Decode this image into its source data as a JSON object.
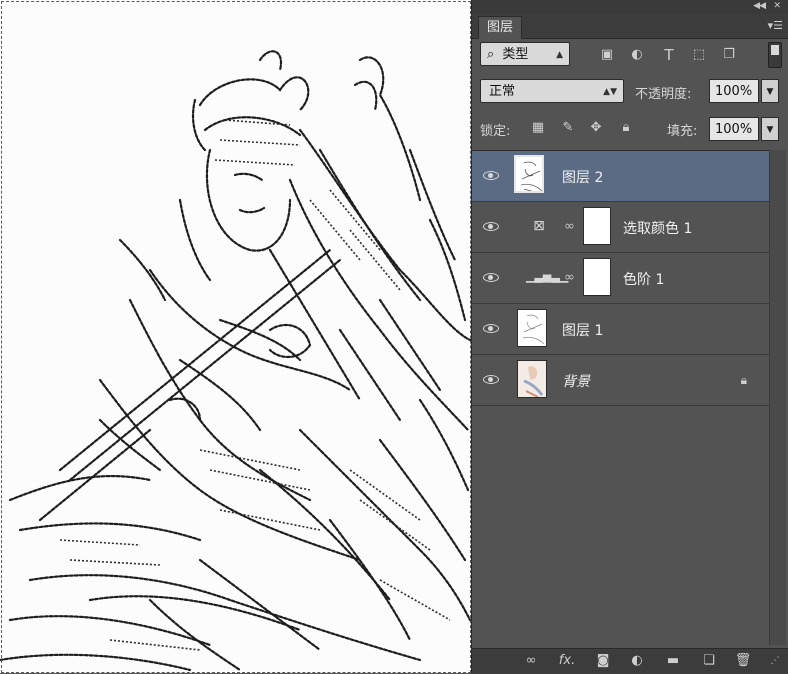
{
  "panel": {
    "tab_title": "图层",
    "filter": {
      "search_icon": "search-icon",
      "value": "类型"
    },
    "blend_mode": "正常",
    "opacity_label": "不透明度:",
    "opacity_value": "100%",
    "lock_label": "锁定:",
    "fill_label": "填充:",
    "fill_value": "100%"
  },
  "layers": [
    {
      "name": "图层 2",
      "type": "pixel",
      "selected": true,
      "visible": true
    },
    {
      "name": "选取颜色 1",
      "type": "adjustment-selective-color",
      "visible": true
    },
    {
      "name": "色阶 1",
      "type": "adjustment-levels",
      "visible": true
    },
    {
      "name": "图层 1",
      "type": "pixel",
      "visible": true
    },
    {
      "name": "背景",
      "type": "background",
      "locked": true,
      "visible": true
    }
  ],
  "colors": {
    "panel_bg": "#535353",
    "selected_row": "#5a6b83",
    "canvas_bg": "#fcfcfc"
  }
}
